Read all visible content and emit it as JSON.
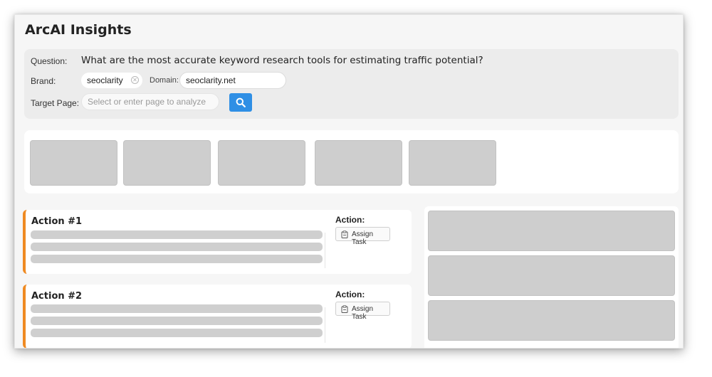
{
  "app": {
    "title": "ArcAI Insights"
  },
  "query": {
    "question_label": "Question:",
    "question_text": "What are the most accurate keyword research tools for estimating traffic potential?",
    "brand_label": "Brand:",
    "brand_value": "seoclarity",
    "domain_label": "Domain:",
    "domain_value": "seoclarity.net",
    "target_page_label": "Target Page:",
    "target_page_placeholder": "Select or enter page to analyze",
    "search_icon": "search-icon"
  },
  "actions": [
    {
      "title": "Action #1",
      "action_label": "Action:",
      "button_label": "Assign Task",
      "button_icon": "clipboard-icon"
    },
    {
      "title": "Action #2",
      "action_label": "Action:",
      "button_label": "Assign Task",
      "button_icon": "clipboard-icon"
    }
  ],
  "colors": {
    "accent_blue": "#2f8fe5",
    "action_border_orange": "#ef8a22",
    "placeholder_gray": "#cecece"
  }
}
